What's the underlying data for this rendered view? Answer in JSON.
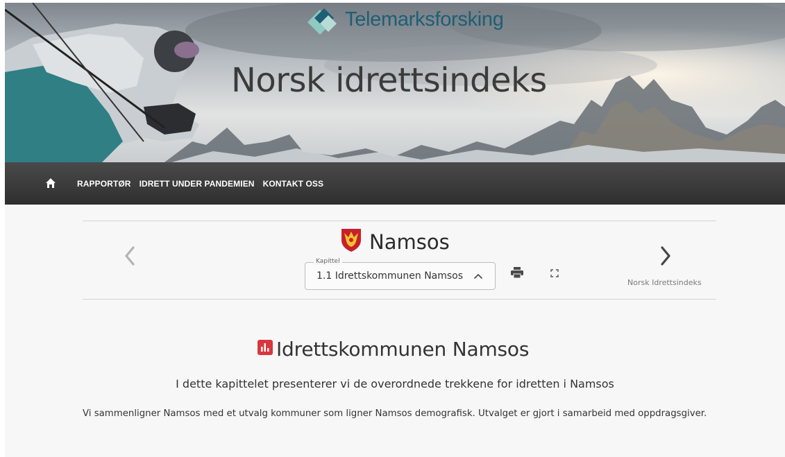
{
  "brand": {
    "logo_text": "Telemarksforsking",
    "site_title": "Norsk idrettsindeks"
  },
  "nav": {
    "home_icon": "home-icon",
    "items": [
      {
        "label": "RAPPORTØR"
      },
      {
        "label": "IDRETT UNDER PANDEMIEN"
      },
      {
        "label": "KONTAKT OSS"
      }
    ]
  },
  "chapter_bar": {
    "municipality": "Namsos",
    "select_label": "Kapittel",
    "select_value": "1.1 Idrettskommunen Namsos",
    "next_label": "Norsk Idrettsindeks",
    "icons": [
      "chevron-left-icon",
      "coat-of-arms-icon",
      "chevron-up-icon",
      "print-icon",
      "fullscreen-icon",
      "chevron-right-icon"
    ]
  },
  "content": {
    "heading": "Idrettskommunen Namsos",
    "heading_icon": "bar-chart-icon",
    "subtitle": "I dette kapittelet presenterer vi de overordnede trekkene for idretten i Namsos",
    "paragraph": "Vi sammenligner Namsos med et utvalg kommuner som ligner Namsos demografisk. Utvalget er gjort i samarbeid med oppdragsgiver."
  },
  "colors": {
    "brand_teal": "#1d5f74",
    "nav_bg": "#3a3a3a",
    "accent_red": "#d9363e",
    "coat_yellow": "#f2c12e",
    "coat_red": "#c8202a"
  }
}
